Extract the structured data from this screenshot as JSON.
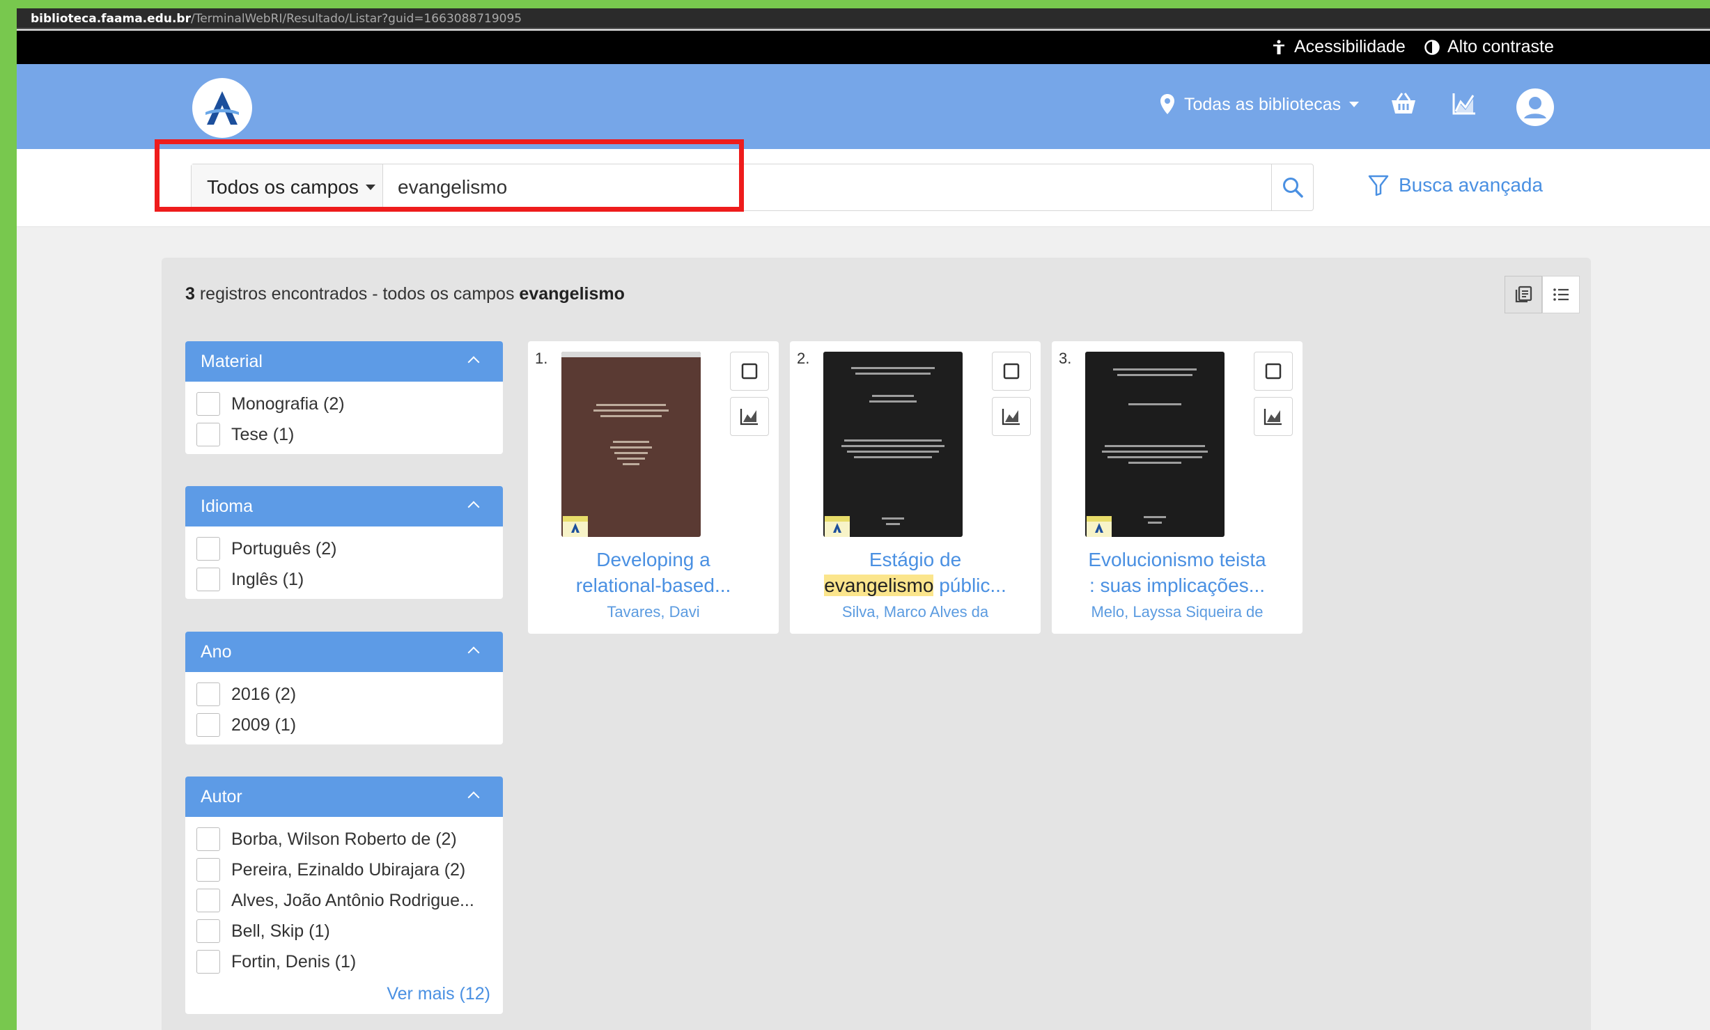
{
  "browser": {
    "url_host": "biblioteca.faama.edu.br",
    "url_path": "/TerminalWebRI/Resultado/Listar?guid=1663088719095"
  },
  "topbar": {
    "accessibility": "Acessibilidade",
    "contrast": "Alto contraste"
  },
  "header": {
    "libraries_label": "Todas as bibliotecas",
    "icons": [
      "location-pin-icon",
      "basket-icon",
      "chart-icon",
      "user-avatar-icon"
    ]
  },
  "search": {
    "field_label": "Todos os campos",
    "query": "evangelismo",
    "advanced_label": "Busca avançada"
  },
  "results": {
    "count": "3",
    "summary_text": " registros encontrados - todos os campos ",
    "summary_term": "evangelismo"
  },
  "facets": [
    {
      "title": "Material",
      "items": [
        "Monografia (2)",
        "Tese (1)"
      ]
    },
    {
      "title": "Idioma",
      "items": [
        "Português (2)",
        "Inglês (1)"
      ]
    },
    {
      "title": "Ano",
      "items": [
        "2016 (2)",
        "2009 (1)"
      ]
    },
    {
      "title": "Autor",
      "items": [
        "Borba, Wilson Roberto de (2)",
        "Pereira, Ezinaldo Ubirajara (2)",
        "Alves, João Antônio Rodrigue...",
        "Bell, Skip (1)",
        "Fortin, Denis (1)"
      ],
      "more": "Ver mais (12)"
    }
  ],
  "cards": [
    {
      "num": "1.",
      "title_line1": "Developing a",
      "title_pre": "",
      "title_highlight": "",
      "title_post": "relational-based...",
      "author": "Tavares, Davi",
      "cover_color": "#5a3a33"
    },
    {
      "num": "2.",
      "title_line1": "Estágio de",
      "title_pre": "",
      "title_highlight": "evangelismo",
      "title_post": " públic...",
      "author": "Silva, Marco Alves da",
      "cover_color": "#1e1e1e"
    },
    {
      "num": "3.",
      "title_line1": "Evolucionismo teista",
      "title_pre": "",
      "title_highlight": "",
      "title_post": ": suas implicações...",
      "author": "Melo, Layssa Siqueira de",
      "cover_color": "#1c1c1c"
    }
  ]
}
